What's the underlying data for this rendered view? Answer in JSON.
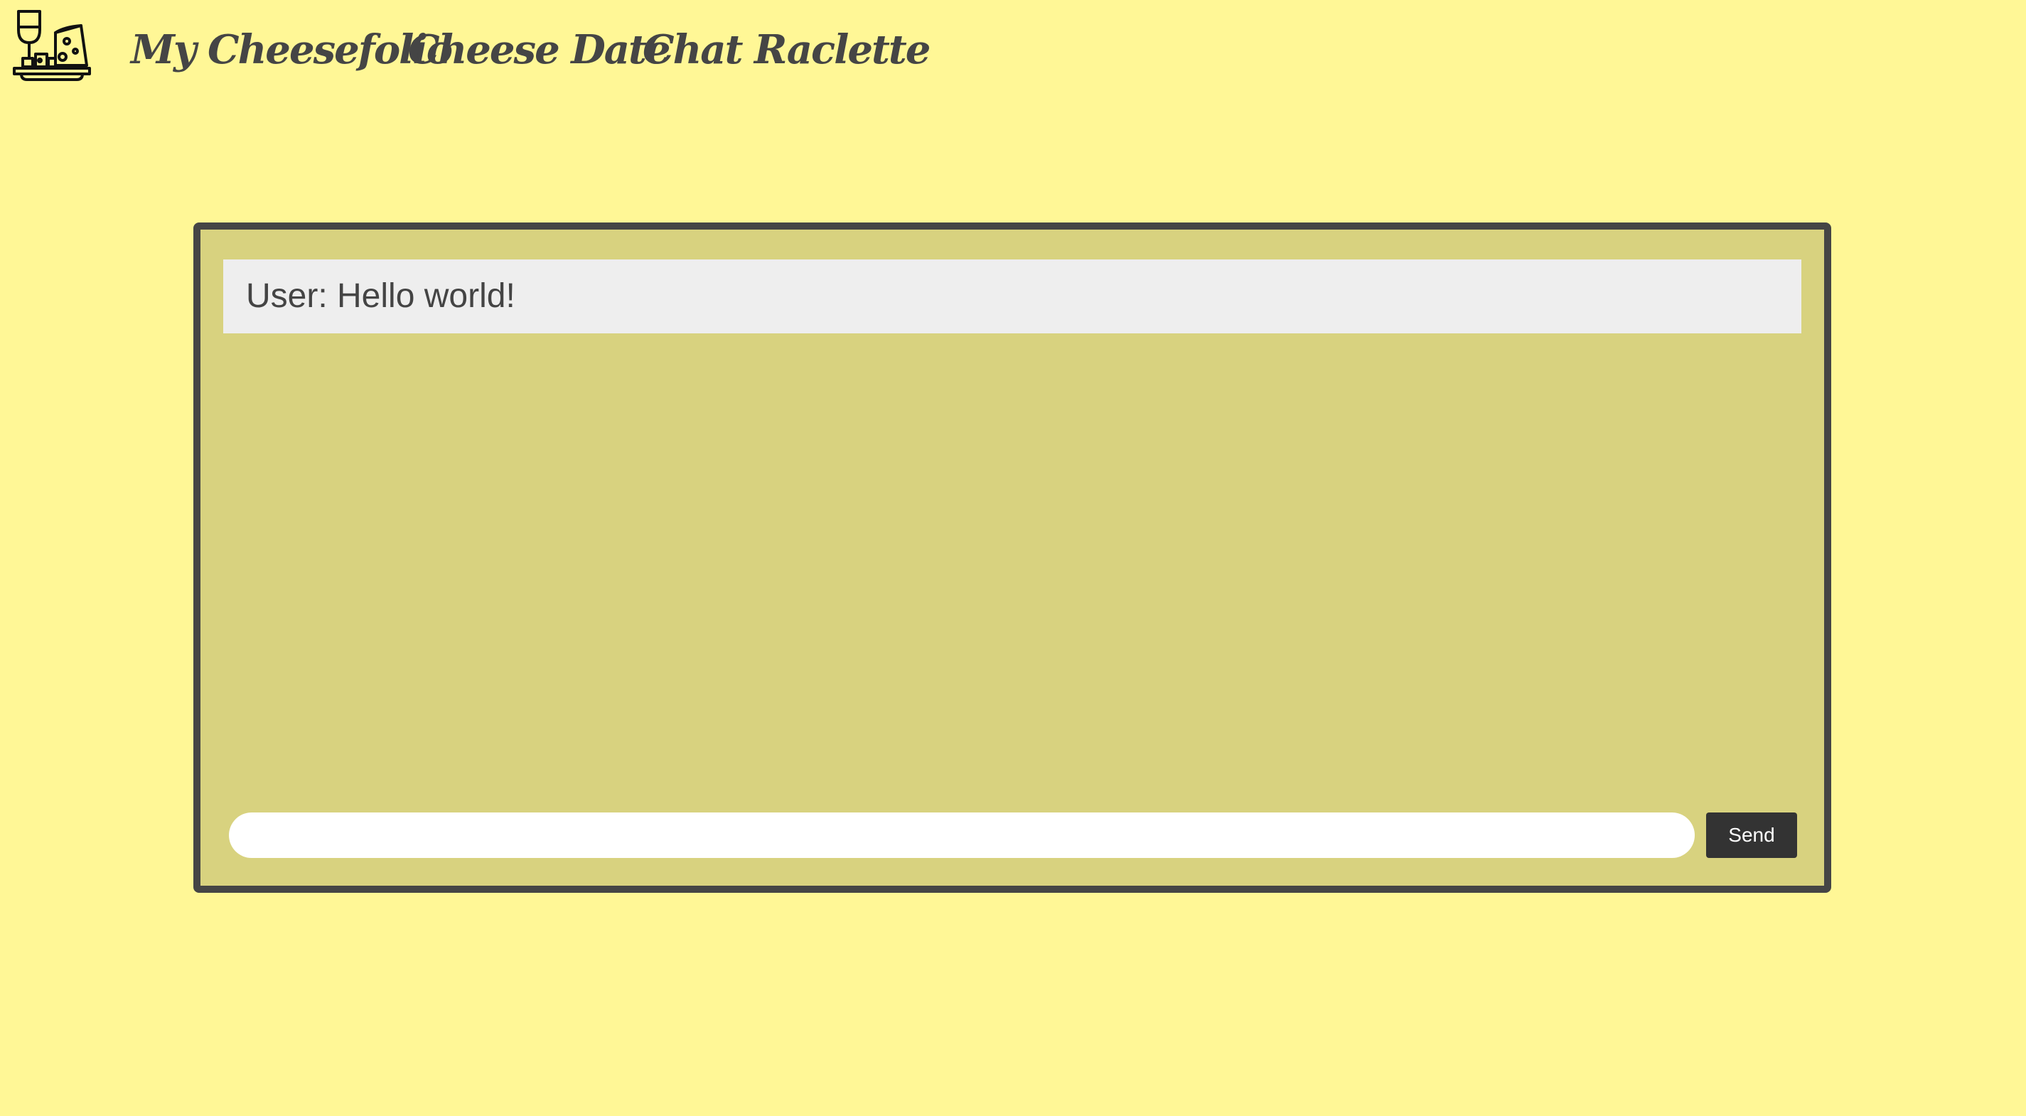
{
  "nav": {
    "logo_icon": "cheese-board-wine-icon",
    "links": [
      {
        "label": "My Cheesefolio"
      },
      {
        "label": "Cheese Date"
      },
      {
        "label": "Chat Raclette"
      }
    ]
  },
  "chat": {
    "messages": [
      {
        "text": "User: Hello world!"
      }
    ],
    "input": {
      "value": "",
      "placeholder": ""
    },
    "send_label": "Send"
  },
  "colors": {
    "page_background": "#fff796",
    "panel_background": "#d8d27f",
    "panel_border": "#454545",
    "message_background": "#eeeeee",
    "nav_text": "#454545",
    "button_background": "#333333",
    "button_text": "#ffffff"
  }
}
